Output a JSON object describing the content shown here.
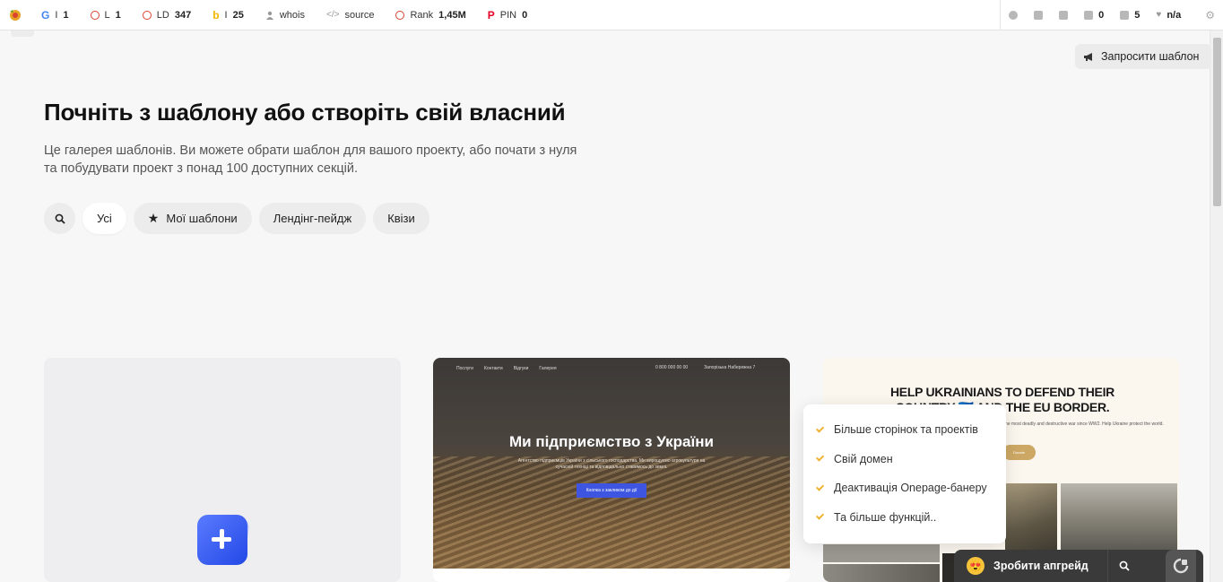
{
  "seo_bar": {
    "items": [
      {
        "icon": "google-icon",
        "label": "I",
        "value": "1"
      },
      {
        "icon": "ring-icon",
        "label": "L",
        "value": "1"
      },
      {
        "icon": "ring-icon",
        "label": "LD",
        "value": "347"
      },
      {
        "icon": "bing-icon",
        "label": "I",
        "value": "25"
      },
      {
        "icon": "user-icon",
        "label": "whois",
        "value": ""
      },
      {
        "icon": "code-icon",
        "label": "source",
        "value": ""
      },
      {
        "icon": "ring-icon",
        "label": "Rank",
        "value": "1,45M"
      },
      {
        "icon": "pinterest-icon",
        "label": "PIN",
        "value": "0"
      }
    ],
    "right_items": [
      {
        "icon": "info-icon",
        "value": ""
      },
      {
        "icon": "monitor-icon",
        "value": ""
      },
      {
        "icon": "table-icon",
        "value": ""
      },
      {
        "icon": "external-link-icon",
        "value": "0"
      },
      {
        "icon": "checklist-icon",
        "value": "5"
      },
      {
        "icon": "heart-icon",
        "value": "n/a"
      },
      {
        "icon": "gear-icon",
        "value": ""
      }
    ]
  },
  "header": {
    "request_template": "Запросити шаблон"
  },
  "main": {
    "title": "Почніть з шаблону або створіть свій власний",
    "subtitle": "Це галерея шаблонів. Ви можете обрати шаблон для вашого проекту, або почати з нуля та побудувати проект з понад 100 доступних секцій.",
    "filters": [
      "Усі",
      "Мої шаблони",
      "Лендінг-пейдж",
      "Квізи"
    ]
  },
  "templates": {
    "tpl1": {
      "nav": [
        "Послуги",
        "Контакти",
        "Відгуки",
        "Галерея"
      ],
      "contact": [
        "0 800 000 00 00",
        "Запорізька Набережна 7"
      ],
      "heading": "Ми підприємство з України",
      "text": "Агентство підприємців України з сільського господарства. Ми вирощуємо агрокультури на сучасній техніці та відповідально ставимось до землі.",
      "button": "Кнопка з закликом до дії"
    },
    "tpl2": {
      "heading": "HELP UKRAINIANS TO DEFEND THEIR COUNTRY 🇺🇦 AND THE EU BORDER.",
      "text": "The most deadly and destructive war since WW2. Help Ukraine protect the world.",
      "button": "Donate"
    }
  },
  "upgrade_popover": {
    "features": [
      "Більше сторінок та проектів",
      "Свій домен",
      "Деактивація Onepage-банеру",
      "Та більше функцій.."
    ]
  },
  "upgrade_bar": {
    "button": "Зробити апгрейд"
  },
  "colors": {
    "accent_blue": "#3d55e0",
    "check_yellow": "#f0b232",
    "gold": "#cda865"
  }
}
